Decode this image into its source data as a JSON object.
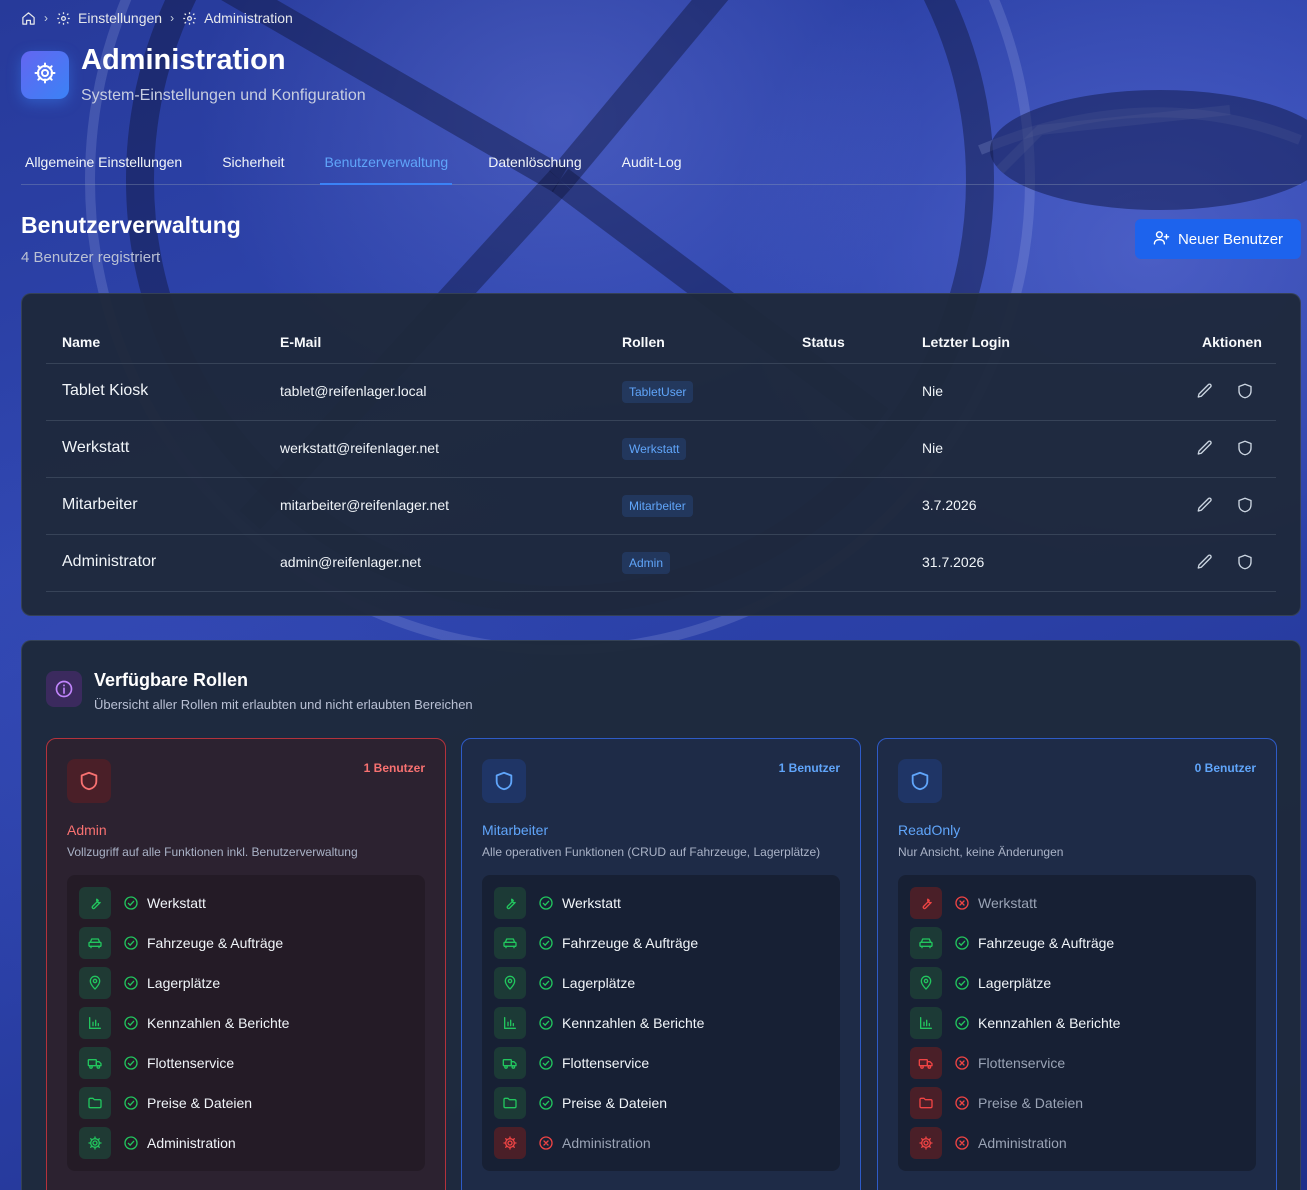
{
  "breadcrumb": {
    "items": [
      {
        "label": ""
      },
      {
        "label": "Einstellungen"
      },
      {
        "label": "Administration"
      }
    ]
  },
  "header": {
    "title": "Administration",
    "subtitle": "System-Einstellungen und Konfiguration"
  },
  "tabs": [
    {
      "label": "Allgemeine Einstellungen",
      "active": false
    },
    {
      "label": "Sicherheit",
      "active": false
    },
    {
      "label": "Benutzerverwaltung",
      "active": true
    },
    {
      "label": "Datenlöschung",
      "active": false
    },
    {
      "label": "Audit-Log",
      "active": false
    }
  ],
  "users_section": {
    "title": "Benutzerverwaltung",
    "subtitle": "4 Benutzer registriert",
    "new_user_button": "Neuer Benutzer"
  },
  "table": {
    "headers": {
      "name": "Name",
      "email": "E-Mail",
      "roles": "Rollen",
      "status": "Status",
      "last_login": "Letzter Login",
      "actions": "Aktionen"
    },
    "rows": [
      {
        "name": "Tablet Kiosk",
        "email": "tablet@reifenlager.local",
        "role": "TabletUser",
        "status": "",
        "last_login": "Nie"
      },
      {
        "name": "Werkstatt",
        "email": "werkstatt@reifenlager.net",
        "role": "Werkstatt",
        "status": "",
        "last_login": "Nie"
      },
      {
        "name": "Mitarbeiter",
        "email": "mitarbeiter@reifenlager.net",
        "role": "Mitarbeiter",
        "status": "",
        "last_login": "3.7.2026"
      },
      {
        "name": "Administrator",
        "email": "admin@reifenlager.net",
        "role": "Admin",
        "status": "",
        "last_login": "31.7.2026"
      }
    ]
  },
  "roles_section": {
    "title": "Verfügbare Rollen",
    "subtitle": "Übersicht aller Rollen mit erlaubten und nicht erlaubten Bereichen",
    "roles": [
      {
        "name": "Admin",
        "count": "1 Benutzer",
        "description": "Vollzugriff auf alle Funktionen inkl. Benutzerverwaltung",
        "permissions": [
          {
            "label": "Werkstatt",
            "allowed": true,
            "icon": "wrench-icon"
          },
          {
            "label": "Fahrzeuge & Aufträge",
            "allowed": true,
            "icon": "car-icon"
          },
          {
            "label": "Lagerplätze",
            "allowed": true,
            "icon": "map-pin-icon"
          },
          {
            "label": "Kennzahlen & Berichte",
            "allowed": true,
            "icon": "bar-chart-icon"
          },
          {
            "label": "Flottenservice",
            "allowed": true,
            "icon": "truck-icon"
          },
          {
            "label": "Preise & Dateien",
            "allowed": true,
            "icon": "folder-icon"
          },
          {
            "label": "Administration",
            "allowed": true,
            "icon": "gear-icon"
          }
        ]
      },
      {
        "name": "Mitarbeiter",
        "count": "1 Benutzer",
        "description": "Alle operativen Funktionen (CRUD auf Fahrzeuge, Lagerplätze)",
        "permissions": [
          {
            "label": "Werkstatt",
            "allowed": true,
            "icon": "wrench-icon"
          },
          {
            "label": "Fahrzeuge & Aufträge",
            "allowed": true,
            "icon": "car-icon"
          },
          {
            "label": "Lagerplätze",
            "allowed": true,
            "icon": "map-pin-icon"
          },
          {
            "label": "Kennzahlen & Berichte",
            "allowed": true,
            "icon": "bar-chart-icon"
          },
          {
            "label": "Flottenservice",
            "allowed": true,
            "icon": "truck-icon"
          },
          {
            "label": "Preise & Dateien",
            "allowed": true,
            "icon": "folder-icon"
          },
          {
            "label": "Administration",
            "allowed": false,
            "icon": "gear-icon"
          }
        ]
      },
      {
        "name": "ReadOnly",
        "count": "0 Benutzer",
        "description": "Nur Ansicht, keine Änderungen",
        "permissions": [
          {
            "label": "Werkstatt",
            "allowed": false,
            "icon": "wrench-icon"
          },
          {
            "label": "Fahrzeuge & Aufträge",
            "allowed": true,
            "icon": "car-icon"
          },
          {
            "label": "Lagerplätze",
            "allowed": true,
            "icon": "map-pin-icon"
          },
          {
            "label": "Kennzahlen & Berichte",
            "allowed": true,
            "icon": "bar-chart-icon"
          },
          {
            "label": "Flottenservice",
            "allowed": false,
            "icon": "truck-icon"
          },
          {
            "label": "Preise & Dateien",
            "allowed": false,
            "icon": "folder-icon"
          },
          {
            "label": "Administration",
            "allowed": false,
            "icon": "gear-icon"
          }
        ]
      }
    ]
  },
  "colors": {
    "accent": "#3b82f6",
    "allowed": "#22c55e",
    "denied": "#ef4444",
    "admin_border": "#b4323c"
  }
}
